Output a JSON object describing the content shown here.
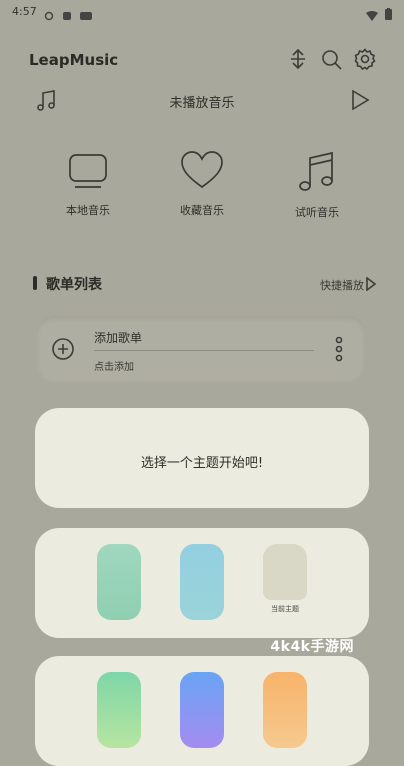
{
  "status_bar": {
    "time": "4:57"
  },
  "header": {
    "title": "LeapMusic",
    "icons": [
      "sort-icon",
      "search-icon",
      "gear-icon"
    ]
  },
  "player": {
    "now_playing": "未播放音乐",
    "icons": [
      "music-note-icon",
      "play-icon"
    ]
  },
  "categories": [
    {
      "label": "本地音乐",
      "icon": "monitor-icon"
    },
    {
      "label": "收藏音乐",
      "icon": "heart-icon"
    },
    {
      "label": "试听音乐",
      "icon": "music-notes-icon"
    }
  ],
  "playlist_section": {
    "title": "歌单列表",
    "quick_play": "快捷播放"
  },
  "add_playlist": {
    "title": "添加歌单",
    "subtitle": "点击添加"
  },
  "theme": {
    "prompt": "选择一个主题开始吧!",
    "current_label": "当前主题"
  },
  "colors": {
    "background": "#a9a89c",
    "card": "#ecebdf"
  },
  "watermark": "4k4k手游网"
}
